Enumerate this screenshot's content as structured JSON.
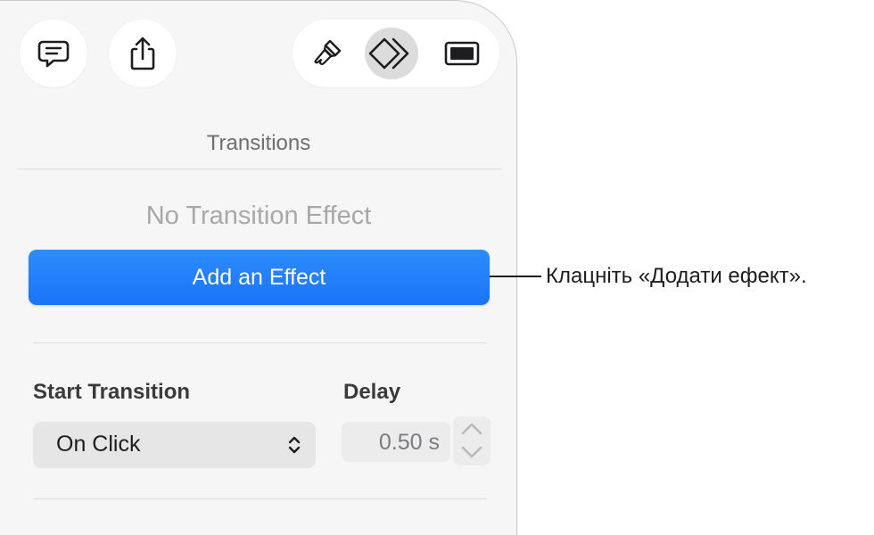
{
  "toolbar": {
    "comment_icon": "comment-icon",
    "share_icon": "share-icon",
    "format_icon": "paintbrush-icon",
    "animate_icon": "animate-diamond-icon",
    "document_icon": "document-icon"
  },
  "transitions": {
    "section_title": "Transitions",
    "empty_state": "No Transition Effect",
    "add_button_label": "Add an Effect"
  },
  "start_transition": {
    "label": "Start Transition",
    "selected": "On Click"
  },
  "delay": {
    "label": "Delay",
    "value": "0.50 s"
  },
  "callout": {
    "text": "Клацніть «Додати ефект»."
  },
  "colors": {
    "accent": "#1a74f5",
    "panel_bg": "#f6f6f6"
  }
}
